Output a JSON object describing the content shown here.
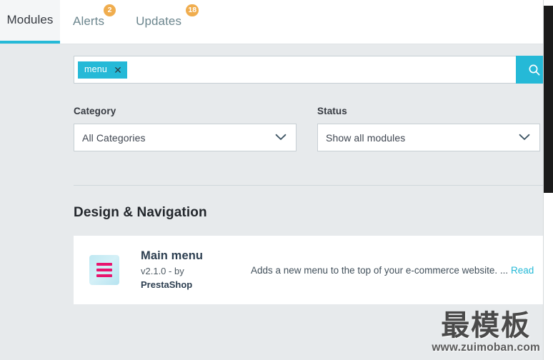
{
  "colors": {
    "accent": "#25b9d7",
    "badge": "#f0ad4e",
    "page_bg": "#e7eaec",
    "card_bg": "#ffffff",
    "icon_bar": "#e8156e",
    "icon_tile": "#c8ecf5"
  },
  "tabs": [
    {
      "label": "Modules",
      "badge": "",
      "active": true
    },
    {
      "label": "Alerts",
      "badge": "2",
      "active": false
    },
    {
      "label": "Updates",
      "badge": "18",
      "active": false
    }
  ],
  "search": {
    "chip_label": "menu",
    "chip_close_icon": "close-icon",
    "input_value": "",
    "placeholder": "",
    "button_icon": "search-icon"
  },
  "filters": [
    {
      "label": "Category",
      "value": "All Categories",
      "caret_icon": "chevron-down-icon"
    },
    {
      "label": "Status",
      "value": "Show all modules",
      "caret_icon": "chevron-down-icon"
    }
  ],
  "section": {
    "title": "Design & Navigation"
  },
  "module": {
    "icon_name": "hamburger-menu-icon",
    "name": "Main menu",
    "version": "v2.1.0 - by",
    "author": "PrestaShop",
    "description": "Adds a new menu to the top of your e-commerce website. ...",
    "read_more": "Read"
  },
  "watermark": {
    "title": "最模板",
    "url": "www.zuimoban.com"
  }
}
